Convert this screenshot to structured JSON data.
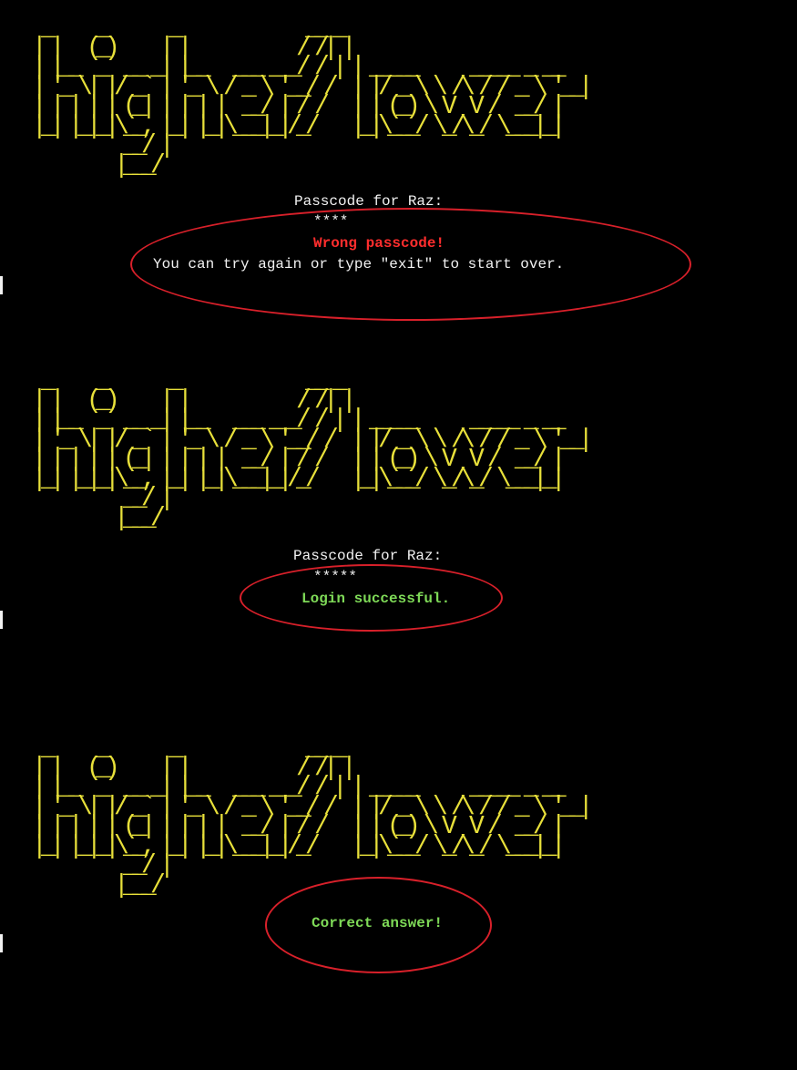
{
  "banner_art": " _     _       _              __ _\n| |   (_)     | |            / /| |\n| |__  _  __ _| |__   ___ _ _/ / | | _____      _____ _ __\n| '_ \\| |/ _` | '_ \\ / _ \\ '__/ /  | |/ _ \\ \\ /\\ / / _ \\ '__|\n| | | | | (_| | | | |  __/ | / /   | | (_) \\ V  V /  __/ |\n|_| |_|_|\\__, |_| |_|\\___|_|/_/    |_|\\___/ \\_/\\_/ \\___|_|\n          __/ |\n         |___/",
  "colors": {
    "background": "#000000",
    "banner": "#e8e03a",
    "text": "#f2f2f2",
    "error": "#ff2d2d",
    "success": "#7ed957",
    "annotation": "#d8202a"
  },
  "panel_wrong": {
    "prompt": "Passcode for Raz:",
    "masked_input": "****",
    "error_message": "Wrong passcode!",
    "hint": "You can try again or type \"exit\" to start over."
  },
  "panel_login": {
    "prompt": "Passcode for Raz:",
    "masked_input": "*****",
    "success_message": "Login successful."
  },
  "panel_answer": {
    "success_message": "Correct answer!"
  }
}
